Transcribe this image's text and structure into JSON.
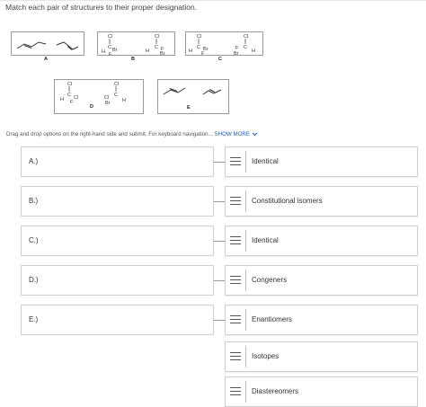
{
  "question": {
    "prompt": "Match each pair of structures to their proper designation.",
    "instructions": "Drag and drop options on the right-hand side and submit. For keyboard navigation...",
    "show_more": "SHOW MORE"
  },
  "structures": [
    {
      "letter": "A"
    },
    {
      "letter": "B"
    },
    {
      "letter": "C"
    },
    {
      "letter": "D"
    },
    {
      "letter": "E"
    }
  ],
  "atoms": {
    "cl": "Cl",
    "h": "H",
    "c": "C",
    "f": "F",
    "br": "Br"
  },
  "targets": [
    {
      "label": "A.)"
    },
    {
      "label": "B.)"
    },
    {
      "label": "C.)"
    },
    {
      "label": "D.)"
    },
    {
      "label": "E.)"
    }
  ],
  "options": [
    {
      "label": "Identical"
    },
    {
      "label": "Constitutional isomers"
    },
    {
      "label": "Identical"
    },
    {
      "label": "Congeners"
    },
    {
      "label": "Enantiomers"
    },
    {
      "label": "Isotopes"
    },
    {
      "label": "Diastereomers"
    }
  ],
  "icons": {
    "handle": "drag-handle-icon",
    "chevron": "chevron-down-icon"
  },
  "colors": {
    "link": "#1a5fb4",
    "border": "#d0d0d0"
  }
}
